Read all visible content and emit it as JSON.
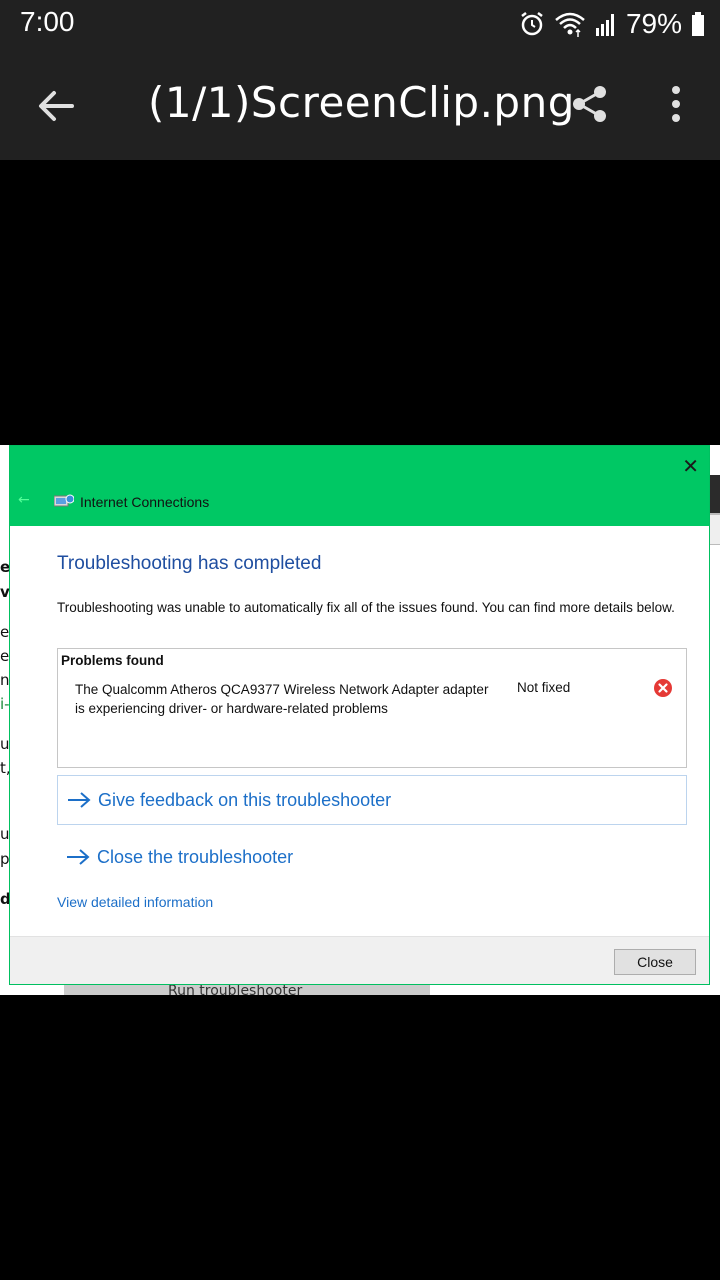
{
  "status_bar": {
    "time": "7:00",
    "battery_percent": "79%",
    "icons": [
      "alarm-icon",
      "wifi-icon",
      "signal-icon",
      "battery-icon"
    ]
  },
  "app_bar": {
    "title": "(1/1)ScreenClip.png",
    "icons": [
      "back-arrow-icon",
      "share-icon",
      "more-vert-icon"
    ]
  },
  "dialog": {
    "window_title": "Internet Connections",
    "heading": "Troubleshooting has completed",
    "description": "Troubleshooting was unable to automatically fix all of the issues found. You can find more details below.",
    "problems": {
      "title": "Problems found",
      "items": [
        {
          "description": "The Qualcomm Atheros QCA9377 Wireless Network Adapter adapter is experiencing driver- or hardware-related problems",
          "status": "Not fixed",
          "status_icon": "error-icon"
        }
      ]
    },
    "links": {
      "feedback": "Give feedback on this troubleshooter",
      "close_troubleshooter": "Close the troubleshooter",
      "detailed_info": "View detailed information"
    },
    "close_button": "Close",
    "accent_color": "#00c864",
    "link_color": "#1c6fc8",
    "heading_color": "#1f4ea0"
  },
  "background": {
    "left_fragments": [
      "e",
      "vs",
      "e",
      "ec",
      "n",
      "i-",
      "u",
      "t,",
      "u",
      "p",
      "d"
    ],
    "bottom_button": "Run troubleshooter"
  }
}
